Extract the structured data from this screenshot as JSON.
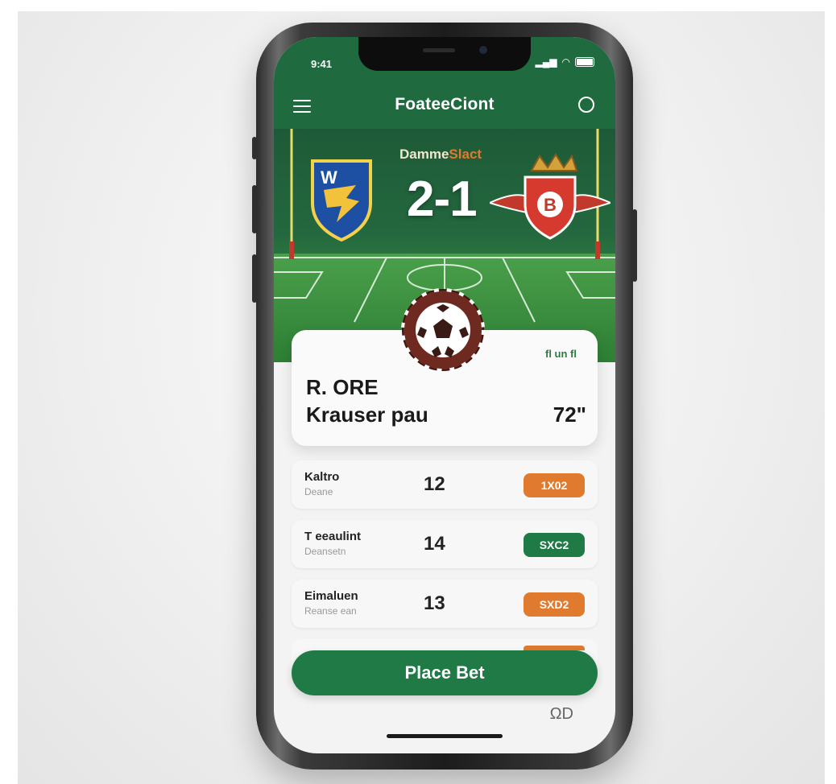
{
  "status": {
    "time": "9:41"
  },
  "header": {
    "title": "FoateeCiont"
  },
  "match": {
    "label_main": "Damme",
    "label_highlight": "Slact",
    "score": "2-1",
    "home_crest_letter": "W",
    "away_crest_letter": "B"
  },
  "card": {
    "live_label": "fl un fl",
    "team_line1": "R. ORE",
    "team_line2": "Krauser pau",
    "minute": "72\""
  },
  "odds": [
    {
      "name": "Kaltro",
      "sub": "Deane",
      "value": "12",
      "button": "1X02",
      "color": "#e07a2e"
    },
    {
      "name": "T eeaulint",
      "sub": "Deansetn",
      "value": "14",
      "button": "SXC2",
      "color": "#1f7a45"
    },
    {
      "name": "Eimaluen",
      "sub": "Reanse ean",
      "value": "13",
      "button": "SXD2",
      "color": "#e07a2e"
    }
  ],
  "actions": {
    "place_bet": "Place Bet",
    "footer_icon_text": "ΩD"
  },
  "colors": {
    "primary_green": "#1f6b3f",
    "accent_orange": "#e07a2e"
  }
}
